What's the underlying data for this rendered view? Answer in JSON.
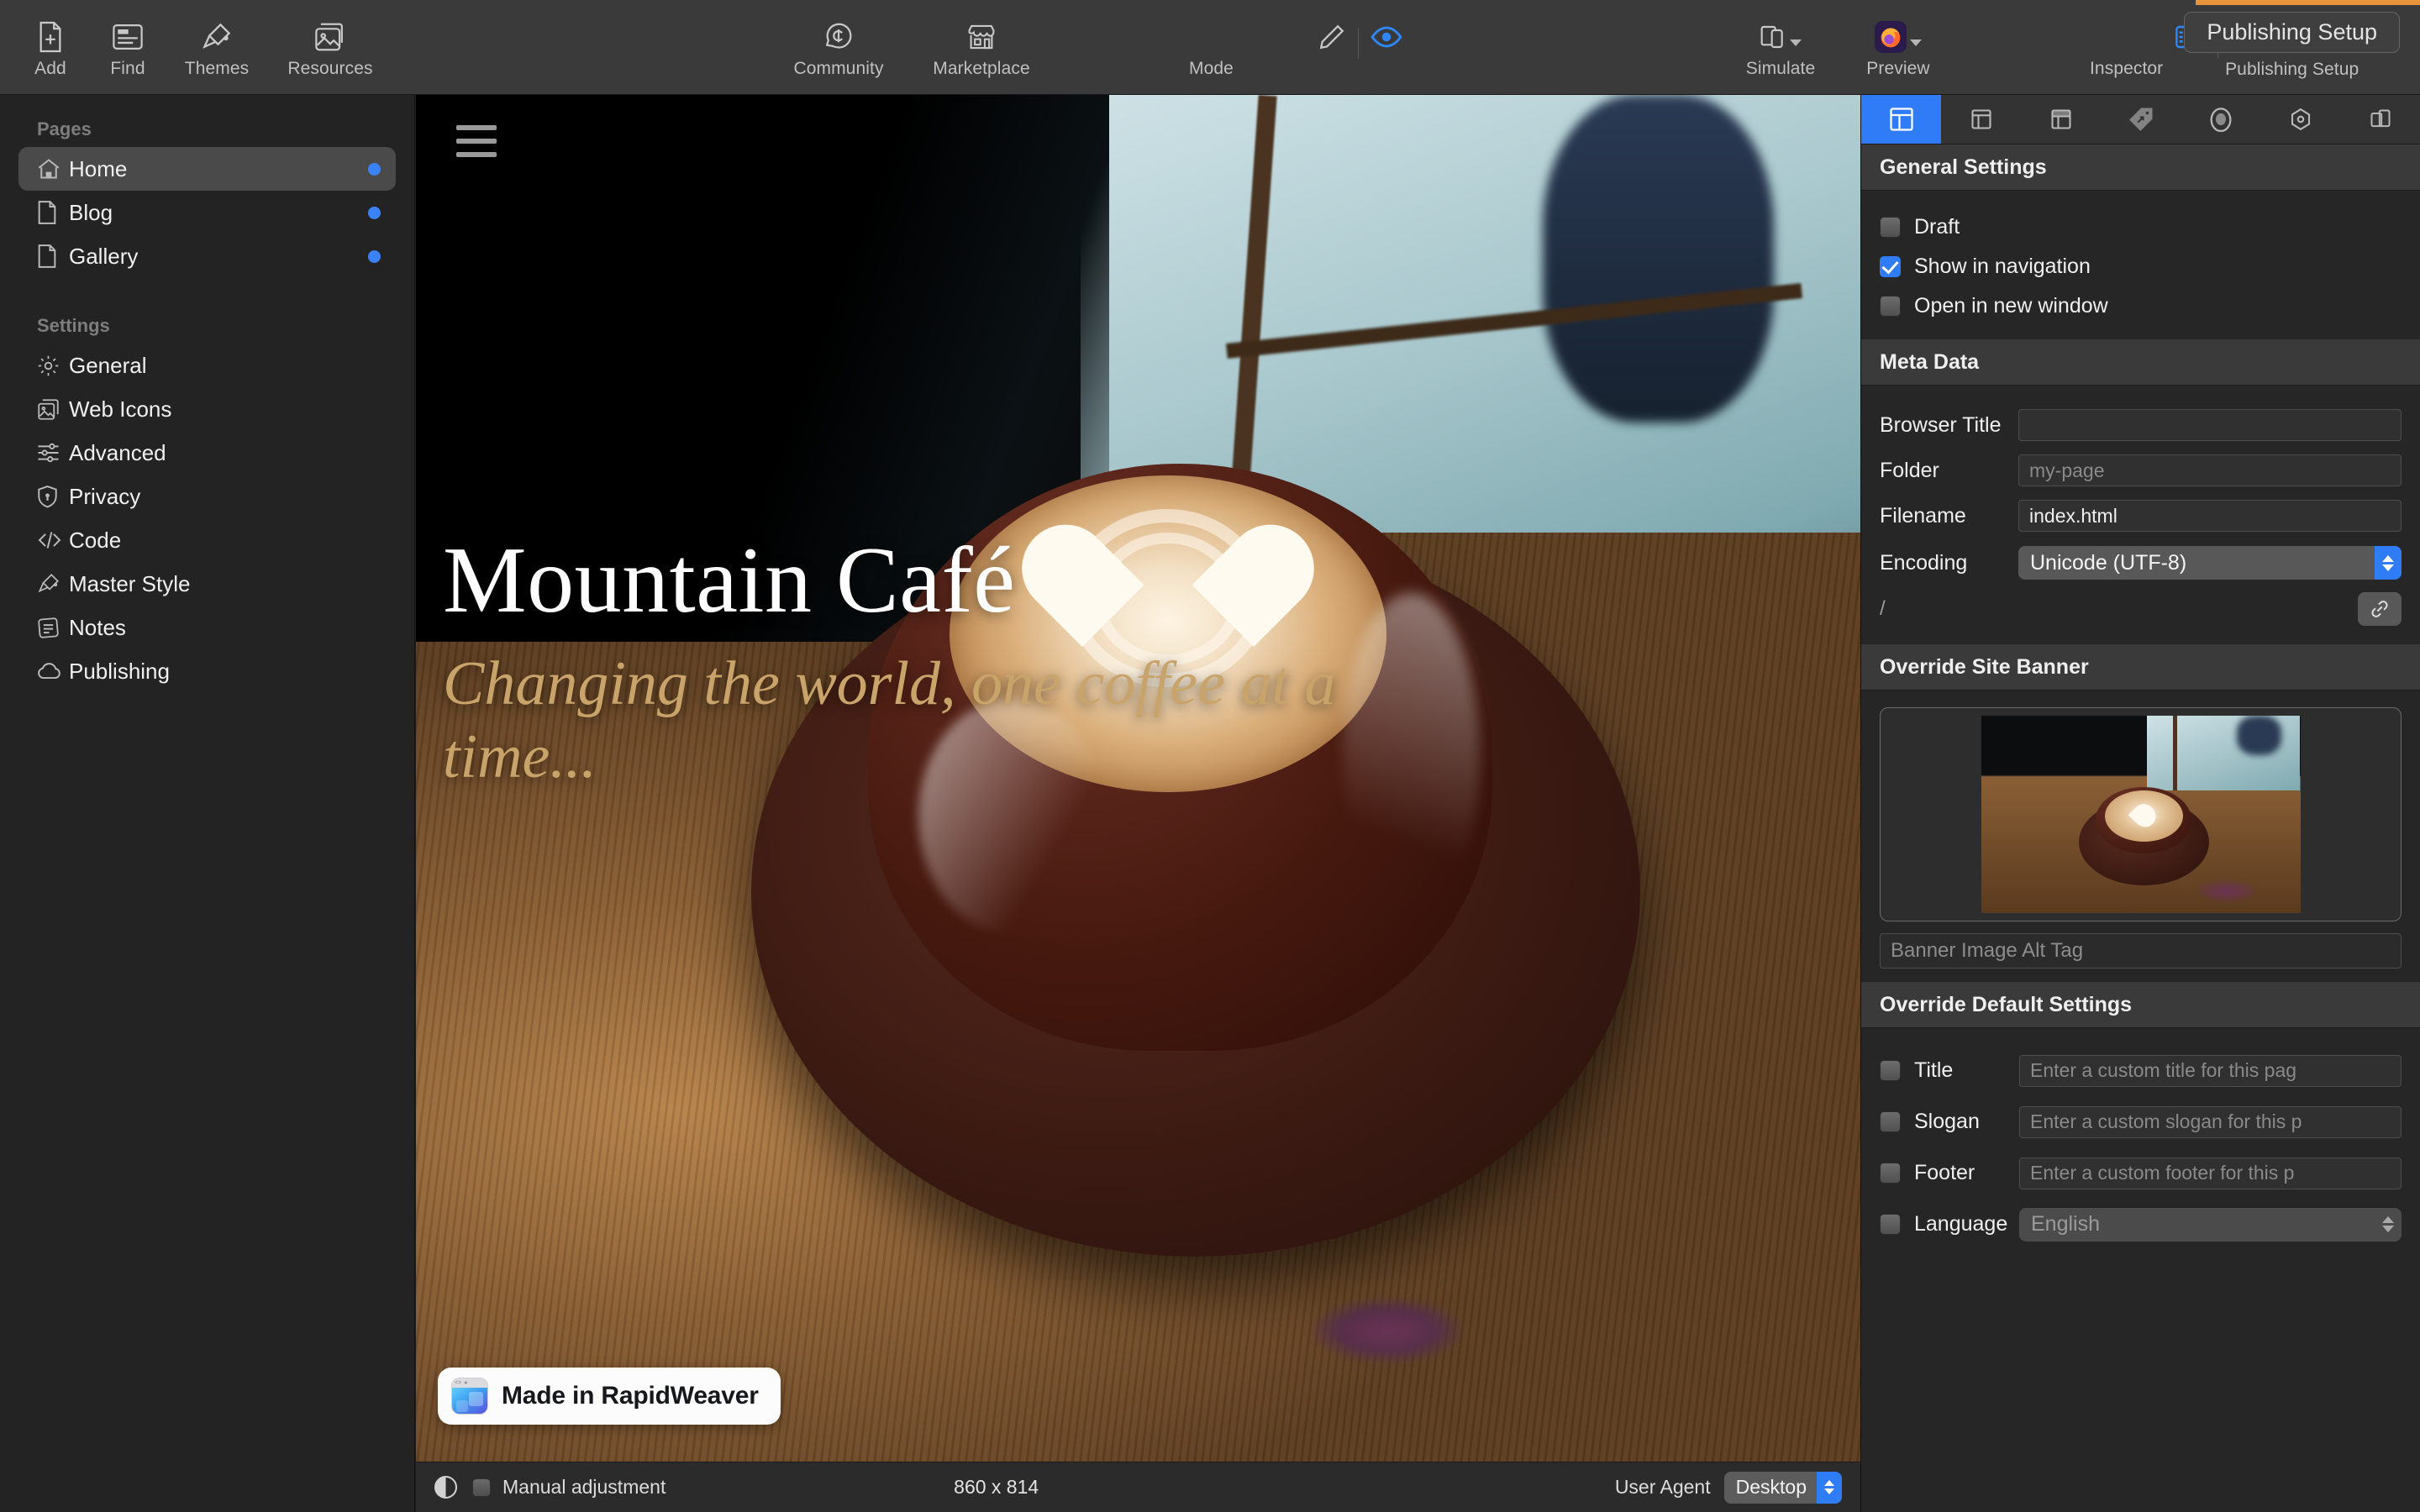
{
  "toolbar": {
    "left_items": [
      {
        "label": "Add",
        "icon": "add-page-icon"
      },
      {
        "label": "Find",
        "icon": "find-icon"
      },
      {
        "label": "Themes",
        "icon": "themes-brush-icon"
      },
      {
        "label": "Resources",
        "icon": "resources-images-icon"
      }
    ],
    "center_items": [
      {
        "label": "Community",
        "icon": "community-chat-icon"
      },
      {
        "label": "Marketplace",
        "icon": "marketplace-store-icon"
      }
    ],
    "mode": {
      "label": "Mode",
      "edit_icon": "pencil-icon",
      "preview_icon": "eye-icon",
      "active": "preview"
    },
    "right_items": [
      {
        "label": "Simulate",
        "icon": "devices-icon"
      },
      {
        "label": "Preview",
        "icon": "firefox-icon"
      }
    ],
    "inspector": {
      "label": "Inspector",
      "left_icon": "sidebar-left-icon",
      "right_icon": "sidebar-right-icon"
    },
    "publishing": {
      "button_label": "Publishing Setup",
      "caption": "Publishing Setup",
      "accent_color": "#e8923a"
    }
  },
  "sidebar": {
    "pages_header": "Pages",
    "pages": [
      {
        "label": "Home",
        "icon": "home-icon",
        "selected": true,
        "dot": true
      },
      {
        "label": "Blog",
        "icon": "page-icon",
        "selected": false,
        "dot": true
      },
      {
        "label": "Gallery",
        "icon": "page-icon",
        "selected": false,
        "dot": true
      }
    ],
    "settings_header": "Settings",
    "settings": [
      {
        "label": "General",
        "icon": "gear-icon"
      },
      {
        "label": "Web Icons",
        "icon": "web-icons-icon"
      },
      {
        "label": "Advanced",
        "icon": "sliders-icon"
      },
      {
        "label": "Privacy",
        "icon": "shield-icon"
      },
      {
        "label": "Code",
        "icon": "code-icon"
      },
      {
        "label": "Master Style",
        "icon": "brush-icon"
      },
      {
        "label": "Notes",
        "icon": "notes-icon"
      },
      {
        "label": "Publishing",
        "icon": "cloud-icon"
      }
    ]
  },
  "canvas": {
    "hamburger": "hamburger-menu-icon",
    "hero_title": "Mountain Café",
    "hero_slogan": "Changing the world, one coffee at a time...",
    "badge_text": "Made in RapidWeaver",
    "badge_icon": "rapidweaver-app-icon"
  },
  "statusbar": {
    "contrast_icon": "contrast-icon",
    "manual_label": "Manual adjustment",
    "manual_checked": false,
    "dimensions": "860 x 814",
    "user_agent_label": "User Agent",
    "user_agent_value": "Desktop"
  },
  "inspector": {
    "tabs": [
      {
        "icon": "page-layout-icon",
        "active": true
      },
      {
        "icon": "sidebar-layout-icon",
        "active": false
      },
      {
        "icon": "header-layout-icon",
        "active": false
      },
      {
        "icon": "tag-icon",
        "active": false
      },
      {
        "icon": "target-icon",
        "active": false
      },
      {
        "icon": "hexagon-icon",
        "active": false
      },
      {
        "icon": "stacks-icon",
        "active": false
      }
    ],
    "general": {
      "title": "General Settings",
      "checkboxes": [
        {
          "label": "Draft",
          "checked": false
        },
        {
          "label": "Show in navigation",
          "checked": true
        },
        {
          "label": "Open in new window",
          "checked": false
        }
      ]
    },
    "meta": {
      "title": "Meta Data",
      "browser_title_label": "Browser Title",
      "browser_title_value": "",
      "folder_label": "Folder",
      "folder_placeholder": "my-page",
      "filename_label": "Filename",
      "filename_value": "index.html",
      "encoding_label": "Encoding",
      "encoding_value": "Unicode (UTF-8)",
      "path_preview": "/",
      "link_icon": "link-icon"
    },
    "banner": {
      "title": "Override Site Banner",
      "thumbnail_icon": "banner-thumbnail",
      "alt_placeholder": "Banner Image Alt Tag"
    },
    "overrides": {
      "title": "Override Default Settings",
      "rows": [
        {
          "label": "Title",
          "checked": false,
          "placeholder": "Enter a custom title for this pag",
          "type": "text"
        },
        {
          "label": "Slogan",
          "checked": false,
          "placeholder": "Enter a custom slogan for this p",
          "type": "text"
        },
        {
          "label": "Footer",
          "checked": false,
          "placeholder": "Enter a custom footer for this p",
          "type": "text"
        },
        {
          "label": "Language",
          "checked": false,
          "placeholder": "English",
          "type": "select"
        }
      ]
    }
  }
}
